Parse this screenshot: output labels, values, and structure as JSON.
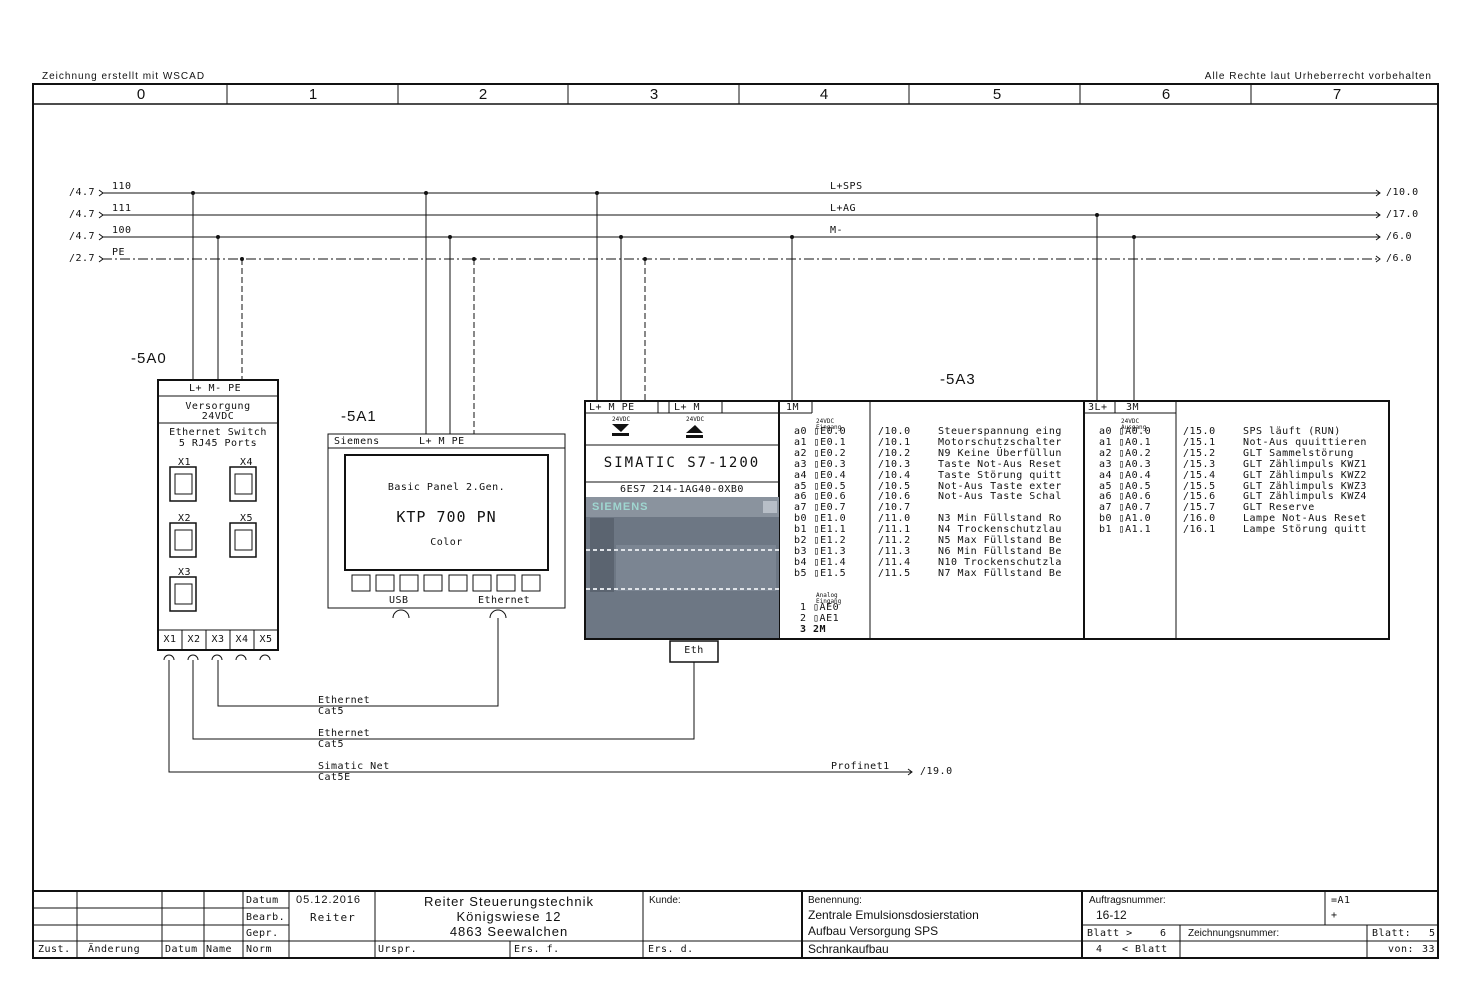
{
  "header": {
    "left_note": "Zeichnung erstellt mit WSCAD",
    "right_note": "Alle Rechte laut Urheberrecht vorbehalten",
    "columns": [
      "0",
      "1",
      "2",
      "3",
      "4",
      "5",
      "6",
      "7"
    ]
  },
  "busbars": [
    {
      "ref_in": "/4.7",
      "num": "110",
      "name": "L+SPS",
      "ref_out": "/10.0"
    },
    {
      "ref_in": "/4.7",
      "num": "111",
      "name": "L+AG",
      "ref_out": "/17.0"
    },
    {
      "ref_in": "/4.7",
      "num": "100",
      "name": "M-",
      "ref_out": "/6.0"
    },
    {
      "ref_in": "/2.7",
      "num": "PE",
      "name": "",
      "ref_out": "/6.0"
    }
  ],
  "switch": {
    "ref": "-5A0",
    "terminals": "L+  M-  PE",
    "supply_label": "Versorgung",
    "supply_voltage": "24VDC",
    "title": "Ethernet Switch",
    "subtitle": "5 RJ45 Ports",
    "port_labels": [
      "X1",
      "X4",
      "X2",
      "X5",
      "X3"
    ],
    "bottom_ports": [
      "X1",
      "X2",
      "X3",
      "X4",
      "X5"
    ]
  },
  "panel": {
    "ref": "-5A1",
    "brand": "Siemens",
    "terminals": "L+  M  PE",
    "line1": "Basic Panel 2.Gen.",
    "model": "KTP 700 PN",
    "line3": "Color",
    "usb": "USB",
    "ethernet": "Ethernet"
  },
  "plc": {
    "ref": "-5A3",
    "term_a": "L+  M  PE",
    "term_b": "L+  M",
    "small_24": "24VDC",
    "small_in": "Eingang",
    "small_out": "Ausgang",
    "name": "SIMATIC S7-1200",
    "order_no": "6ES7 214-1AG40-0XB0",
    "logo": "SIEMENS",
    "eth": "Eth",
    "in_common": "1M",
    "out_common_1": "3L+",
    "out_common_2": "3M",
    "analog_label_1": "Analog",
    "analog_label_2": "Eingang",
    "analog": [
      "1 ▯AE0",
      "2 ▯AE1",
      "3  2M"
    ],
    "inputs": [
      {
        "pin": "a0 ▯E0.0",
        "ref": "/10.0",
        "text": "Steuerspannung eing"
      },
      {
        "pin": "a1 ▯E0.1",
        "ref": "/10.1",
        "text": "Motorschutzschalter"
      },
      {
        "pin": "a2 ▯E0.2",
        "ref": "/10.2",
        "text": "N9 Keine Überfüllun"
      },
      {
        "pin": "a3 ▯E0.3",
        "ref": "/10.3",
        "text": "Taste Not-Aus Reset"
      },
      {
        "pin": "a4 ▯E0.4",
        "ref": "/10.4",
        "text": "Taste Störung quitt"
      },
      {
        "pin": "a5 ▯E0.5",
        "ref": "/10.5",
        "text": "Not-Aus Taste exter"
      },
      {
        "pin": "a6 ▯E0.6",
        "ref": "/10.6",
        "text": "Not-Aus Taste Schal"
      },
      {
        "pin": "a7 ▯E0.7",
        "ref": "/10.7",
        "text": ""
      },
      {
        "pin": "b0 ▯E1.0",
        "ref": "/11.0",
        "text": "N3 Min Füllstand Ro"
      },
      {
        "pin": "b1 ▯E1.1",
        "ref": "/11.1",
        "text": "N4 Trockenschutzlau"
      },
      {
        "pin": "b2 ▯E1.2",
        "ref": "/11.2",
        "text": "N5 Max Füllstand Be"
      },
      {
        "pin": "b3 ▯E1.3",
        "ref": "/11.3",
        "text": "N6 Min Füllstand Be"
      },
      {
        "pin": "b4 ▯E1.4",
        "ref": "/11.4",
        "text": "N10 Trockenschutzla"
      },
      {
        "pin": "b5 ▯E1.5",
        "ref": "/11.5",
        "text": "N7 Max Füllstand Be"
      }
    ],
    "outputs": [
      {
        "pin": "a0 ▯A0.0",
        "ref": "/15.0",
        "text": "SPS läuft (RUN)"
      },
      {
        "pin": "a1 ▯A0.1",
        "ref": "/15.1",
        "text": "Not-Aus quuittieren"
      },
      {
        "pin": "a2 ▯A0.2",
        "ref": "/15.2",
        "text": "GLT Sammelstörung"
      },
      {
        "pin": "a3 ▯A0.3",
        "ref": "/15.3",
        "text": "GLT Zählimpuls KWZ1"
      },
      {
        "pin": "a4 ▯A0.4",
        "ref": "/15.4",
        "text": "GLT Zählimpuls KWZ2"
      },
      {
        "pin": "a5 ▯A0.5",
        "ref": "/15.5",
        "text": "GLT Zählimpuls KWZ3"
      },
      {
        "pin": "a6 ▯A0.6",
        "ref": "/15.6",
        "text": "GLT Zählimpuls KWZ4"
      },
      {
        "pin": "a7 ▯A0.7",
        "ref": "/15.7",
        "text": "GLT Reserve"
      },
      {
        "pin": "b0 ▯A1.0",
        "ref": "/16.0",
        "text": "Lampe Not-Aus Reset"
      },
      {
        "pin": "b1 ▯A1.1",
        "ref": "/16.1",
        "text": "Lampe Störung quitt"
      }
    ]
  },
  "cables": [
    {
      "line1": "Ethernet",
      "line2": "Cat5"
    },
    {
      "line1": "Ethernet",
      "line2": "Cat5"
    },
    {
      "line1": "Simatic Net",
      "line2": "Cat5E"
    }
  ],
  "profinet": {
    "label": "Profinet1",
    "ref": "/19.0"
  },
  "title_block": {
    "datum_label": "Datum",
    "datum": "05.12.2016",
    "bearb_label": "Bearb.",
    "bearb": "Reiter",
    "gepr_label": "Gepr.",
    "norm_label": "Norm",
    "zust": "Zust.",
    "aenderung": "Änderung",
    "datum2": "Datum",
    "name": "Name",
    "company": "Reiter Steuerungstechnik",
    "street": "Königswiese 12",
    "city": "4863 Seewalchen",
    "urspr": "Urspr.",
    "ersf": "Ers. f.",
    "ersd": "Ers. d.",
    "kunde": "Kunde:",
    "benennung": "Benennung:",
    "ben1": "Zentrale Emulsionsdosierstation",
    "ben2": "Aufbau Versorgung SPS",
    "ben3": "Schrankaufbau",
    "auftrag_label": "Auftragsnummer:",
    "auftrag": "16-12",
    "eq": "=A1",
    "plus": "+",
    "blatt_next": "Blatt >",
    "blatt_next_no": "6",
    "blatt_prev_no": "4",
    "blatt_prev": "< Blatt",
    "zeichnung_label": "Zeichnungsnummer:",
    "blatt": "Blatt:",
    "blatt_no": "5",
    "von": "von:",
    "von_no": "33"
  }
}
